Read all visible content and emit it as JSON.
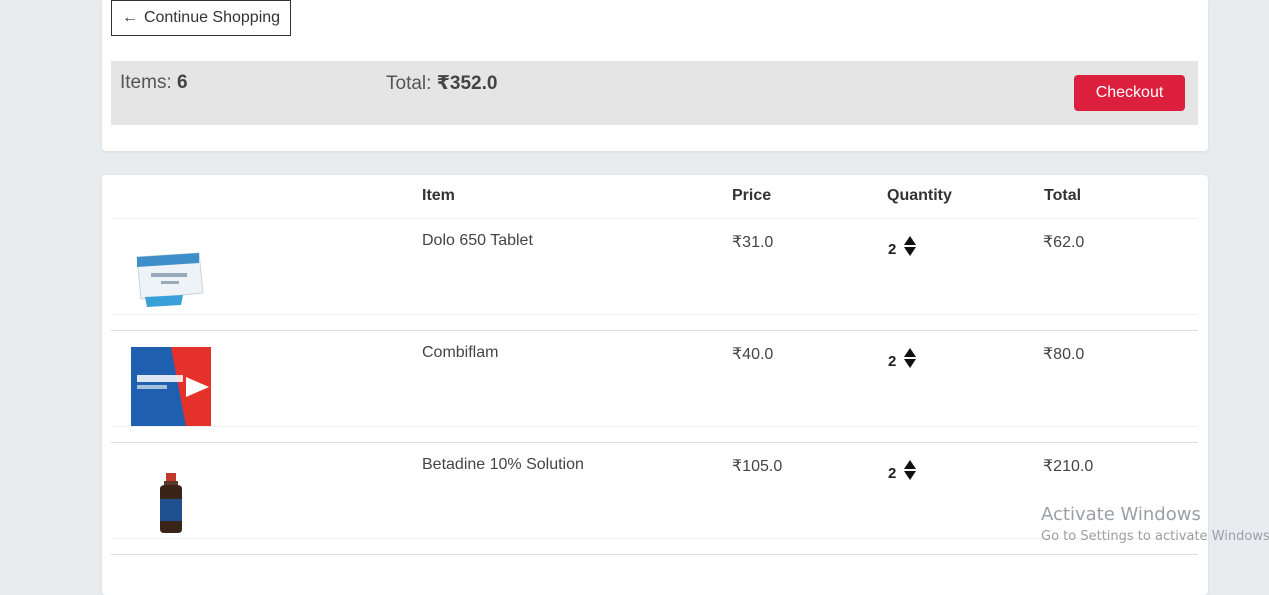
{
  "nav": {
    "continue_label": "Continue Shopping",
    "arrow": "←"
  },
  "summary": {
    "items_label": "Items:",
    "items_count": "6",
    "total_label": "Total:",
    "total_value": "₹352.0",
    "checkout_label": "Checkout"
  },
  "table": {
    "headers": {
      "item": "Item",
      "price": "Price",
      "quantity": "Quantity",
      "total": "Total"
    },
    "rows": [
      {
        "name": "Dolo 650 Tablet",
        "price": "₹31.0",
        "quantity": "2",
        "total": "₹62.0",
        "image": "dolo-650-box"
      },
      {
        "name": "Combiflam",
        "price": "₹40.0",
        "quantity": "2",
        "total": "₹80.0",
        "image": "combiflam-box"
      },
      {
        "name": "Betadine 10% Solution",
        "price": "₹105.0",
        "quantity": "2",
        "total": "₹210.0",
        "image": "betadine-bottle"
      }
    ]
  },
  "watermark": {
    "line1": "Activate Windows",
    "line2": "Go to Settings to activate Windows."
  },
  "colors": {
    "checkout": "#dc1f3c",
    "summary_bg": "#e5e5e5",
    "page_bg": "#e9ecef"
  }
}
